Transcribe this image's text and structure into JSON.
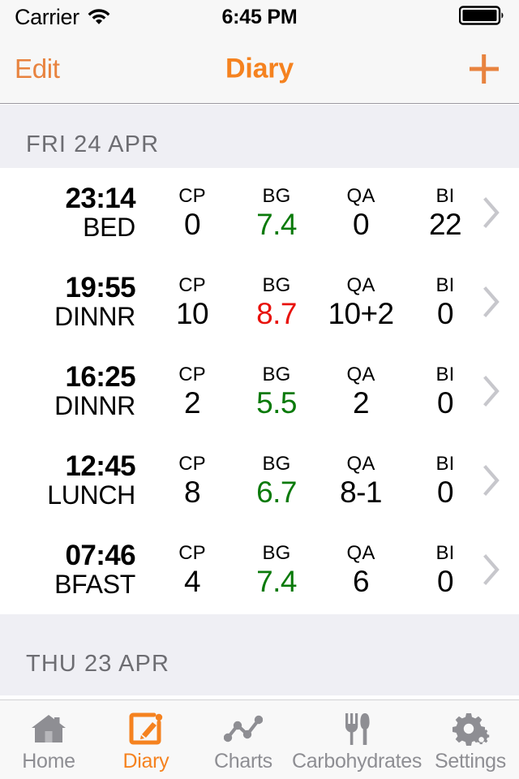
{
  "status_bar": {
    "carrier": "Carrier",
    "wifi_icon": "wifi-icon",
    "time": "6:45 PM",
    "battery_icon": "battery-full-icon"
  },
  "nav_bar": {
    "edit_label": "Edit",
    "title": "Diary",
    "add_icon": "plus-icon"
  },
  "colors": {
    "accent_orange": "#f5821f",
    "edit_orange": "#e8833f",
    "bg_normal_green": "#0a7a0a",
    "bg_high_red": "#e8120c",
    "section_header_bg": "#efeff4",
    "section_header_text": "#6d6d72",
    "tab_inactive": "#8e8e93",
    "chevron_gray": "#c7c7cc"
  },
  "columns": [
    "CP",
    "BG",
    "QA",
    "BI"
  ],
  "sections": [
    {
      "date_label": "FRI 24 APR",
      "entries": [
        {
          "time": "23:14",
          "meal": "BED",
          "cp_header": "CP",
          "cp": "0",
          "bg_header": "BG",
          "bg": "7.4",
          "bg_state": "green",
          "qa_header": "QA",
          "qa": "0",
          "bi_header": "BI",
          "bi": "22",
          "chevron": "chevron-right-icon"
        },
        {
          "time": "19:55",
          "meal": "DINNR",
          "cp_header": "CP",
          "cp": "10",
          "bg_header": "BG",
          "bg": "8.7",
          "bg_state": "red",
          "qa_header": "QA",
          "qa": "10+2",
          "bi_header": "BI",
          "bi": "0",
          "chevron": "chevron-right-icon"
        },
        {
          "time": "16:25",
          "meal": "DINNR",
          "cp_header": "CP",
          "cp": "2",
          "bg_header": "BG",
          "bg": "5.5",
          "bg_state": "green",
          "qa_header": "QA",
          "qa": "2",
          "bi_header": "BI",
          "bi": "0",
          "chevron": "chevron-right-icon"
        },
        {
          "time": "12:45",
          "meal": "LUNCH",
          "cp_header": "CP",
          "cp": "8",
          "bg_header": "BG",
          "bg": "6.7",
          "bg_state": "green",
          "qa_header": "QA",
          "qa": "8-1",
          "bi_header": "BI",
          "bi": "0",
          "chevron": "chevron-right-icon"
        },
        {
          "time": "07:46",
          "meal": "BFAST",
          "cp_header": "CP",
          "cp": "4",
          "bg_header": "BG",
          "bg": "7.4",
          "bg_state": "green",
          "qa_header": "QA",
          "qa": "6",
          "bi_header": "BI",
          "bi": "0",
          "chevron": "chevron-right-icon"
        }
      ]
    },
    {
      "date_label": "THU 23 APR",
      "entries": []
    }
  ],
  "tab_bar": {
    "tabs": [
      {
        "label": "Home",
        "icon": "house-icon",
        "active": false
      },
      {
        "label": "Diary",
        "icon": "pencil-square-icon",
        "active": true
      },
      {
        "label": "Charts",
        "icon": "line-chart-icon",
        "active": false
      },
      {
        "label": "Carbohydrates",
        "icon": "fork-knife-icon",
        "active": false
      },
      {
        "label": "Settings",
        "icon": "gears-icon",
        "active": false
      }
    ]
  }
}
